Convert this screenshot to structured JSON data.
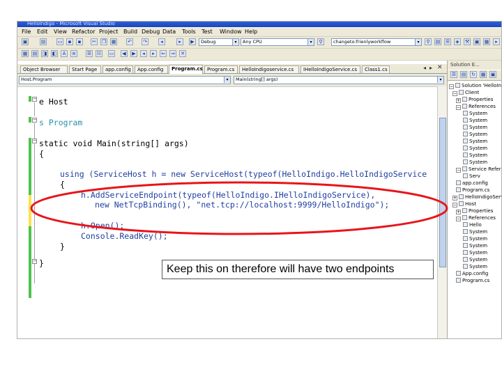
{
  "window": {
    "title": "HelloIndigo - Microsoft Visual Studio"
  },
  "menu": [
    "File",
    "Edit",
    "View",
    "Refactor",
    "Project",
    "Build",
    "Debug",
    "Data",
    "Tools",
    "Test",
    "Window",
    "Help"
  ],
  "toolbar": {
    "config": "Debug",
    "platform": "Any CPU",
    "find": "changeto:frienlyworkflow"
  },
  "tabs": [
    "Object Browser",
    "Start Page",
    "app.config",
    "App.config",
    "Program.cs",
    "Program.cs",
    "HelloIndigoservice.cs",
    "IHelloIndigoService.cs",
    "Class1.cs"
  ],
  "active_tab": 4,
  "nav": {
    "left": "Host.Program",
    "right": "Main(string[] args)"
  },
  "code": {
    "l1": "e Host",
    "l2": "s Program",
    "l3a": "static void Main(string[] args)",
    "l4": "{",
    "l5a": "using (ServiceHost h = new ServiceHost(typeof(HelloIndigo.HelloIndigoService",
    "l6": "{",
    "l7": "h.AddServiceEndpoint(typeof(HelloIndigo.IHelloIndigoService),",
    "l8": "new NetTcpBinding(), \"net.tcp://localhost:9999/HelloIndigo\");",
    "l9": "h.Open();",
    "l10": "Console.ReadKey();",
    "l11": "}",
    "l12": "}"
  },
  "solution_explorer": {
    "title": "Solution E...",
    "items": [
      "Solution 'HelloIndigo'",
      "Client",
      "Properties",
      "References",
      "System",
      "System",
      "System",
      "System",
      "System",
      "System",
      "System",
      "System",
      "Service References",
      "Serv",
      "app.config",
      "Program.cs",
      "HelloIndigoService",
      "Host",
      "Properties",
      "References",
      "Hello",
      "System",
      "System",
      "System",
      "System",
      "System",
      "System",
      "App.config",
      "Program.cs"
    ]
  },
  "annotation": "Keep this on therefore will have two endpoints",
  "colors": {
    "ellipse": "#e8141a",
    "keyword": "#0000ff",
    "type": "#2b91af",
    "string": "#a31515"
  }
}
